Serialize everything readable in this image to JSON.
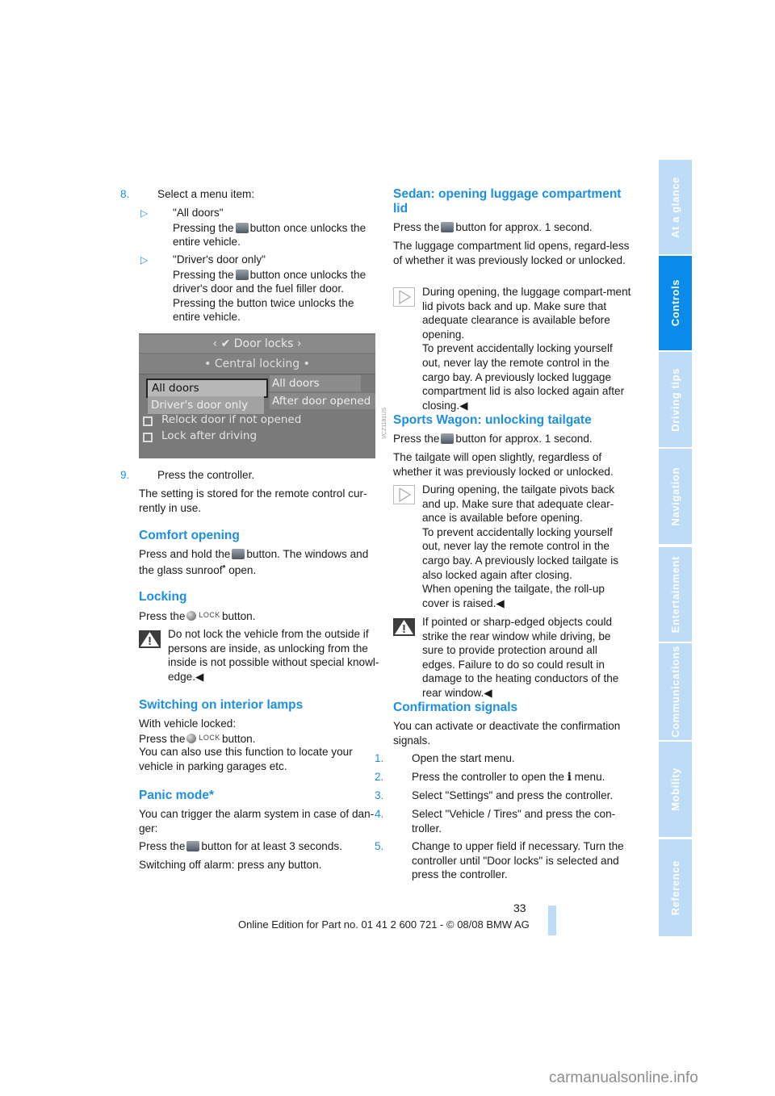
{
  "left": {
    "step8": {
      "num": "8.",
      "text": "Select a menu item:"
    },
    "bullets": [
      {
        "title": "\"All doors\"",
        "pre": "Pressing the",
        "post": "button once unlocks the entire vehicle.",
        "icon": "unlock-button-icon"
      },
      {
        "title": "\"Driver's door only\"",
        "pre": "Pressing the",
        "post": "button once unlocks the driver's door and the fuel filler door. Pressing the button twice unlocks the entire vehicle.",
        "icon": "unlock-button-icon"
      }
    ],
    "screen": {
      "header": "Door locks",
      "subheader": "Central locking",
      "selected": "All doors",
      "option2": "Driver's door only",
      "right1": "All doors",
      "right2": "After door opened",
      "check1": "Relock door if not opened",
      "check2": "Lock after driving",
      "code": "VCZ1181US"
    },
    "step9": {
      "num": "9.",
      "text": "Press the controller."
    },
    "stored": "The setting is stored for the remote control cur-rently in use.",
    "comfort": {
      "heading": "Comfort opening",
      "pre": "Press and hold the",
      "post": "button. The windows and the glass sunroof",
      "star": "*",
      "tail": " open."
    },
    "locking": {
      "heading": "Locking",
      "pre": "Press the",
      "lock_label": "LOCK",
      "post": "button.",
      "warning": "Do not lock the vehicle from the outside if persons are inside, as unlocking from the inside is not possible without special knowl-edge.◀"
    },
    "lamps": {
      "heading": "Switching on interior lamps",
      "line1": "With vehicle locked:",
      "pre": "Press the",
      "lock_label": "LOCK",
      "post": "button.",
      "line3": "You can also use this function to locate your vehicle in parking garages etc."
    },
    "panic": {
      "heading": "Panic mode*",
      "text1": "You can trigger the alarm system in case of dan-ger:",
      "pre": "Press the",
      "post": "button for at least 3 seconds.",
      "text3": "Switching off alarm: press any button."
    }
  },
  "right": {
    "sedan": {
      "heading": "Sedan: opening luggage compartment lid",
      "pre": "Press the",
      "post": "button for approx. 1 second.",
      "text2": "The luggage compartment lid opens, regard-less of whether it was previously locked or unlocked.",
      "note": "During opening, the luggage compart-ment lid pivots back and up. Make sure that adequate clearance is available before opening.\nTo prevent accidentally locking yourself out, never lay the remote control in the cargo bay. A previously locked luggage compartment lid is also locked again after closing.◀"
    },
    "wagon": {
      "heading": "Sports Wagon: unlocking tailgate",
      "pre": "Press the",
      "post": "button for approx. 1 second.",
      "text2": "The tailgate will open slightly, regardless of whether it was previously locked or unlocked.",
      "note": "During opening, the tailgate pivots back and up. Make sure that adequate clear-ance is available before opening.\nTo prevent accidentally locking yourself out, never lay the remote control in the cargo bay. A previously locked tailgate is also locked again after closing.\nWhen opening the tailgate, the roll-up cover is raised.◀",
      "warning": "If pointed or sharp-edged objects could strike the rear window while driving, be sure to provide protection around all edges. Failure to do so could result in damage to the heating conductors of the rear window.◀"
    },
    "confirm": {
      "heading": "Confirmation signals",
      "intro": "You can activate or deactivate the confirmation signals.",
      "steps": [
        {
          "num": "1.",
          "text": "Open the start menu."
        },
        {
          "num": "2.",
          "pre": "Press the controller to open the",
          "icon": "i",
          "post": "menu."
        },
        {
          "num": "3.",
          "text": "Select \"Settings\" and press the controller."
        },
        {
          "num": "4.",
          "text": "Select \"Vehicle / Tires\" and press the con-troller."
        },
        {
          "num": "5.",
          "text": "Change to upper field if necessary. Turn the controller until \"Door locks\" is selected and press the controller."
        }
      ]
    }
  },
  "tabs": [
    {
      "label": "At a glance",
      "active": false
    },
    {
      "label": "Controls",
      "active": true
    },
    {
      "label": "Driving tips",
      "active": false
    },
    {
      "label": "Navigation",
      "active": false
    },
    {
      "label": "Entertainment",
      "active": false
    },
    {
      "label": "Communications",
      "active": false
    },
    {
      "label": "Mobility",
      "active": false
    },
    {
      "label": "Reference",
      "active": false
    }
  ],
  "page_number": "33",
  "footer": "Online Edition for Part no. 01 41 2 600 721 - © 08/08 BMW AG",
  "watermark": "carmanualsonline.info",
  "colors": {
    "accent": "#1a8fe3",
    "tab_active": "#0a8aeb",
    "tab_inactive": "#bcdcf7"
  }
}
